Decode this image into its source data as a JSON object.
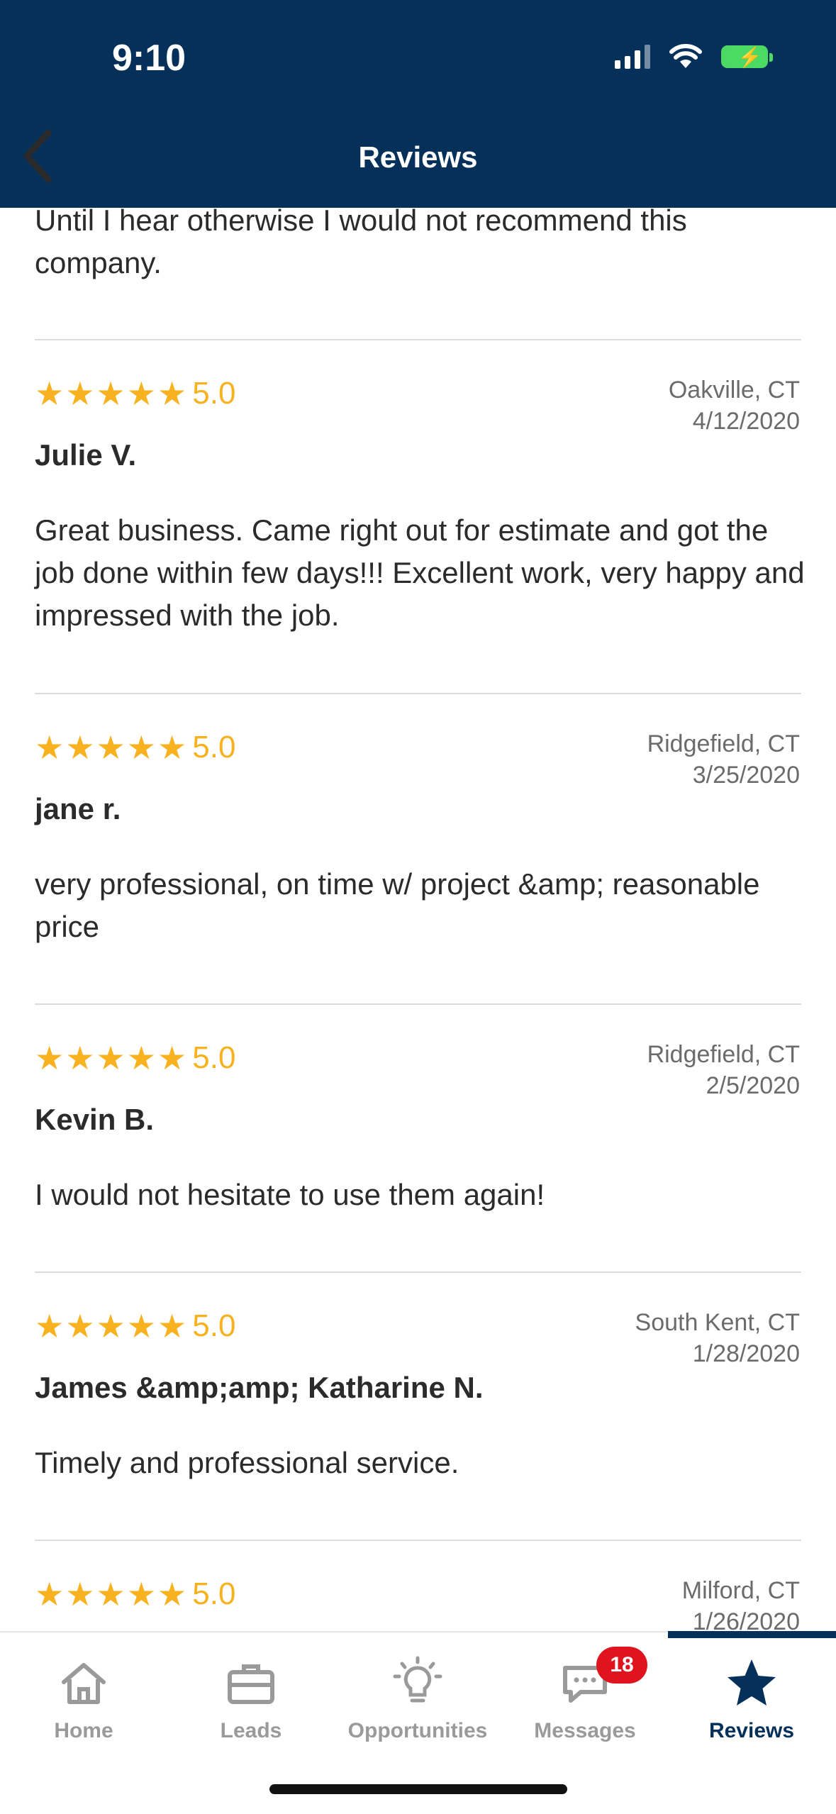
{
  "status": {
    "time": "9:10"
  },
  "header": {
    "title": "Reviews"
  },
  "partial_review": {
    "body": "Until I hear otherwise I would not recommend this company."
  },
  "reviews": [
    {
      "rating": "5.0",
      "author": "Julie V.",
      "location": "Oakville, CT",
      "date": "4/12/2020",
      "body": "Great business. Came right out for estimate and got the job done within few days!!! Excellent work, very happy and impressed with the job."
    },
    {
      "rating": "5.0",
      "author": "jane r.",
      "location": "Ridgefield, CT",
      "date": "3/25/2020",
      "body": "very professional,  on time w/ project &amp; reasonable price"
    },
    {
      "rating": "5.0",
      "author": "Kevin B.",
      "location": "Ridgefield, CT",
      "date": "2/5/2020",
      "body": "I would not hesitate to use them again!"
    },
    {
      "rating": "5.0",
      "author": "James &amp;amp; Katharine N.",
      "location": "South Kent, CT",
      "date": "1/28/2020",
      "body": "Timely and professional service."
    },
    {
      "rating": "5.0",
      "author": "",
      "location": "Milford, CT",
      "date": "1/26/2020",
      "body": ""
    }
  ],
  "tabs": [
    {
      "label": "Home",
      "icon": "home-icon"
    },
    {
      "label": "Leads",
      "icon": "briefcase-icon"
    },
    {
      "label": "Opportunities",
      "icon": "lightbulb-icon"
    },
    {
      "label": "Messages",
      "icon": "chat-icon",
      "badge": "18"
    },
    {
      "label": "Reviews",
      "icon": "star-icon",
      "active": true
    }
  ],
  "colors": {
    "header": "#04305a",
    "star": "#f9b21f",
    "badge": "#e0141e"
  }
}
